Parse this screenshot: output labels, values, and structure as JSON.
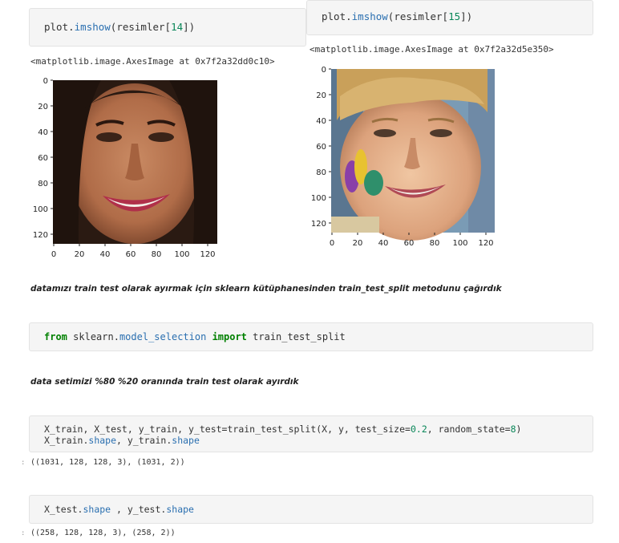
{
  "cell_left_code": {
    "func_prefix": "plot.",
    "func": "imshow",
    "arg_open": "(",
    "var": "resimler",
    "index": "14",
    "arg_close": ")"
  },
  "cell_right_code": {
    "func_prefix": "plot.",
    "func": "imshow",
    "arg_open": "(",
    "var": "resimler",
    "index": "15",
    "arg_close": ")"
  },
  "out_left": "<matplotlib.image.AxesImage at 0x7f2a32dd0c10>",
  "out_right": "<matplotlib.image.AxesImage at 0x7f2a32d5e350>",
  "plot_left": {
    "yticks": [
      "0",
      "20",
      "40",
      "60",
      "80",
      "100",
      "120"
    ],
    "xticks": [
      "0",
      "20",
      "40",
      "60",
      "80",
      "100",
      "120"
    ]
  },
  "plot_right": {
    "yticks": [
      "0",
      "20",
      "40",
      "60",
      "80",
      "100",
      "120"
    ],
    "xticks": [
      "0",
      "20",
      "40",
      "60",
      "80",
      "100",
      "120"
    ]
  },
  "md1": "datamızı train test olarak ayırmak için sklearn kütüphanesinden train_test_split metodunu çağırdık",
  "import_cell": {
    "kw_from": "from",
    "pkg": "sklearn",
    "dot": ".",
    "mod": "model_selection",
    "kw_import": "import",
    "name": "train_test_split"
  },
  "md2": "data setimizi %80 %20 oranında train test olarak ayırdık",
  "split_cell": {
    "line1_a": "X_train, X_test, y_train, y_test=train_test_split(X, y, test_size=",
    "line1_num1": "0.2",
    "line1_b": ", random_state=",
    "line1_num2": "8",
    "line1_c": ")",
    "line2_a": "X_train.",
    "line2_attr1": "shape",
    "line2_b": ", y_train.",
    "line2_attr2": "shape"
  },
  "out_split": "((1031, 128, 128, 3), (1031, 2))",
  "shape_cell": {
    "a": "X_test.",
    "attr1": "shape",
    "b": " , y_test.",
    "attr2": "shape"
  },
  "out_shape": "((258, 128, 128, 3), (258, 2))",
  "colors": {
    "cell_bg": "#f5f5f5",
    "keyword": "#008000",
    "module": "#2a6fb0",
    "number": "#098658"
  }
}
